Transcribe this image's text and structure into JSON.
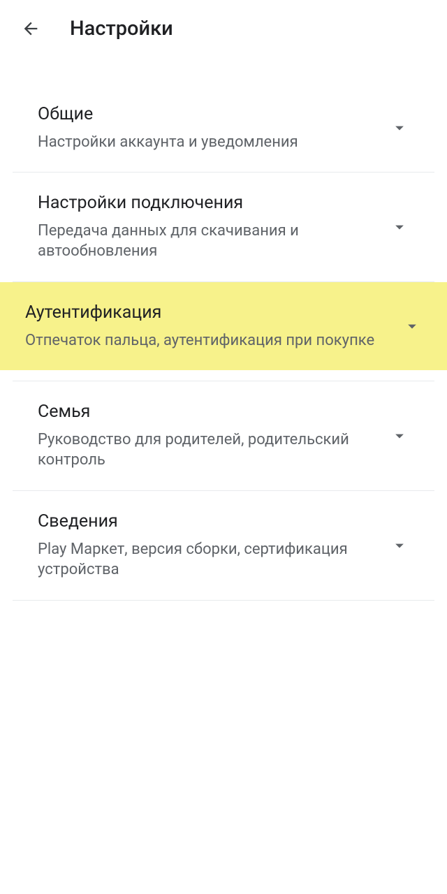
{
  "header": {
    "title": "Настройки"
  },
  "settings": {
    "items": [
      {
        "title": "Общие",
        "subtitle": "Настройки аккаунта и уведомления",
        "highlighted": false
      },
      {
        "title": "Настройки подключения",
        "subtitle": "Передача данных для скачивания и автообновления",
        "highlighted": false
      },
      {
        "title": "Аутентификация",
        "subtitle": "Отпечаток пальца, аутентификация при покупке",
        "highlighted": true
      },
      {
        "title": "Семья",
        "subtitle": "Руководство для родителей, родительский контроль",
        "highlighted": false
      },
      {
        "title": "Сведения",
        "subtitle": "Play Маркет, версия сборки, сертификация устройства",
        "highlighted": false
      }
    ]
  }
}
